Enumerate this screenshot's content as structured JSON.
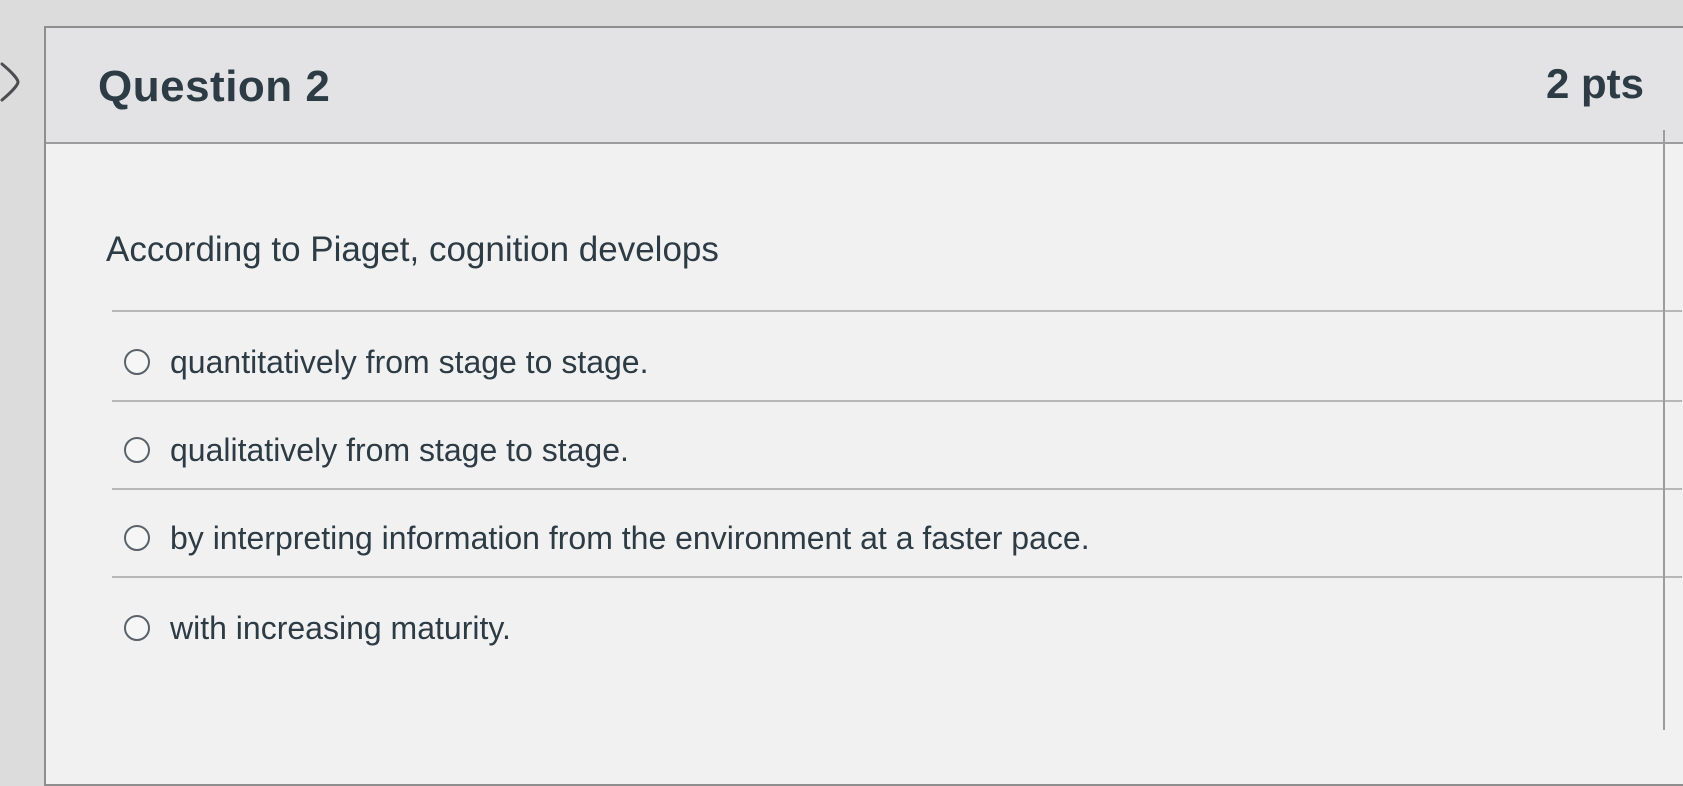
{
  "question": {
    "title": "Question 2",
    "points": "2 pts",
    "text": "According to Piaget, cognition develops"
  },
  "answers": [
    {
      "label": "quantitatively from stage to stage.",
      "selected": false
    },
    {
      "label": "qualitatively from stage to stage.",
      "selected": false
    },
    {
      "label": "by interpreting information from the environment at a faster pace.",
      "selected": false
    },
    {
      "label": "with increasing maturity.",
      "selected": false
    }
  ],
  "icons": {
    "nav": "chevron-right-icon"
  },
  "colors": {
    "text": "#2d3b45",
    "header_bg": "#e3e3e5",
    "card_bg": "#f1f1f2",
    "border": "#8e8e8e"
  }
}
